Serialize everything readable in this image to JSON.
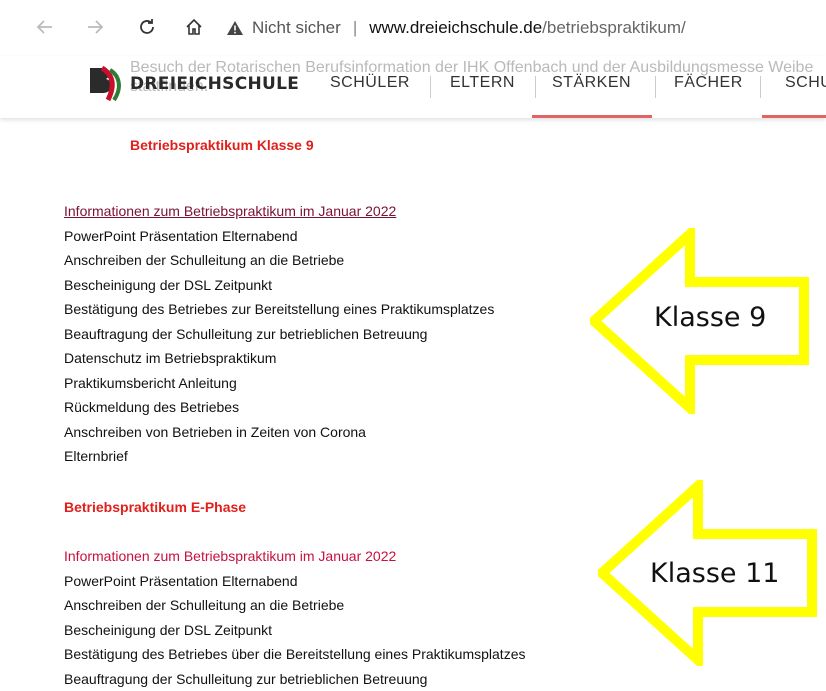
{
  "browser": {
    "security_label": "Nicht sicher",
    "separator": "|",
    "url_domain": "www.dreieichschule.de",
    "url_path": "/betriebspraktikum/"
  },
  "site": {
    "logo_text": "DREIEICHSCHULE",
    "ghost_text_line1": "Besuch der Rotarischen Berufsinformation der IHK Offenbach und der Ausbildungsmesse Weibe",
    "ghost_text_line2": "stattfinden.",
    "nav": [
      "SCHÜLER",
      "ELTERN",
      "STÄRKEN",
      "FÄCHER",
      "SCHU"
    ]
  },
  "section1": {
    "heading": "Betriebspraktikum Klasse 9",
    "link": "Informationen zum Betriebspraktikum im Januar 2022",
    "items": [
      "PowerPoint Präsentation Elternabend",
      "Anschreiben der Schulleitung an die Betriebe",
      "Bescheinigung der DSL Zeitpunkt",
      "Bestätigung des Betriebes zur Bereitstellung eines Praktikumsplatzes",
      "Beauftragung der Schulleitung zur betrieblichen Betreuung",
      "Datenschutz im Betriebspraktikum",
      "Praktikumsbericht Anleitung",
      "Rückmeldung des Betriebes",
      "Anschreiben von Betrieben in Zeiten von Corona",
      "Elternbrief"
    ]
  },
  "section2": {
    "heading": "Betriebspraktikum E-Phase",
    "link": "Informationen zum Betriebspraktikum im Januar 2022",
    "items": [
      "PowerPoint Präsentation Elternabend",
      "Anschreiben der Schulleitung an die Betriebe",
      "Bescheinigung der DSL Zeitpunkt",
      "Bestätigung des Betriebes über die Bereitstellung eines Praktikumsplatzes",
      "Beauftragung der Schulleitung zur betrieblichen Betreuung"
    ]
  },
  "annotations": {
    "arrow1_label": "Klasse 9",
    "arrow2_label": "Klasse 11",
    "arrow_color": "#ffff00"
  },
  "colors": {
    "heading_red": "#e0201c",
    "link_color": "#7a1033",
    "nav_underline": "#e06464"
  }
}
